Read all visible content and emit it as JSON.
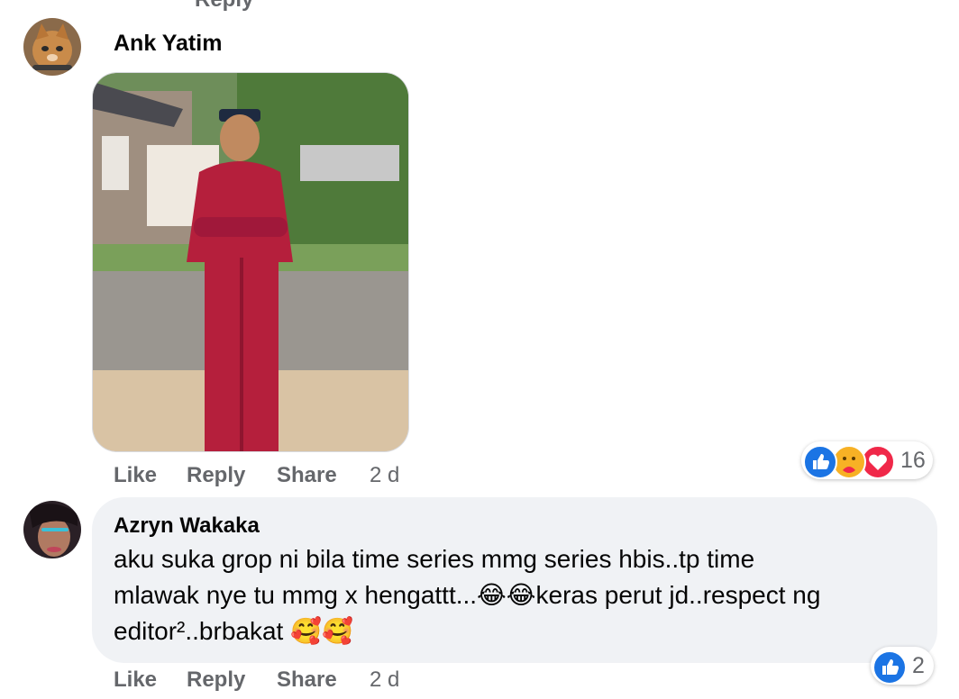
{
  "top_cut_text": "Reply",
  "comments": [
    {
      "author": "Ank Yatim",
      "actions": {
        "like": "Like",
        "reply": "Reply",
        "share": "Share"
      },
      "time": "2 d",
      "reaction_count": "16",
      "reactions": [
        "like-icon",
        "care-icon",
        "love-icon"
      ]
    },
    {
      "author": "Azryn Wakaka",
      "text_line1": "aku suka grop ni bila time series mmg series hbis..tp time",
      "text_line2": "mlawak nye tu mmg x hengattt...😂😂keras perut jd..respect ng",
      "text_line3": "editor².​.brbakat 🥰🥰",
      "actions": {
        "like": "Like",
        "reply": "Reply",
        "share": "Share"
      },
      "time": "2 d",
      "reaction_count": "2",
      "reactions": [
        "like-icon"
      ]
    }
  ],
  "colors": {
    "like_blue": "#1b74e4",
    "love_red": "#f02849",
    "care_yellow": "#f7b125",
    "meta_gray": "#65676b",
    "bubble_gray": "#f0f2f5"
  }
}
